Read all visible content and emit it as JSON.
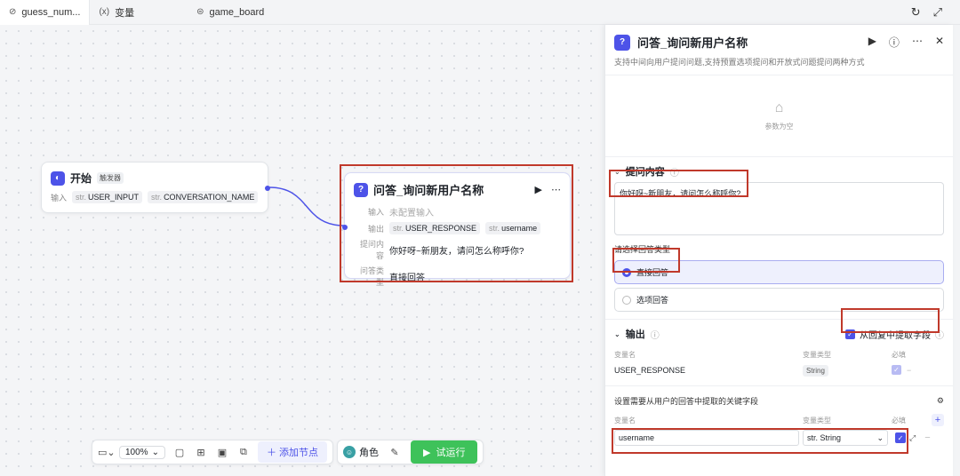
{
  "tabs": [
    {
      "icon": "⊘",
      "label": "guess_num..."
    },
    {
      "icon": "(x)",
      "label": "变量"
    },
    {
      "icon": "⊜",
      "label": "game_board"
    }
  ],
  "top_right": {
    "refresh": "↻",
    "expand": "⤢"
  },
  "start_node": {
    "title": "开始",
    "trigger_tag": "触发器",
    "input_label": "输入",
    "inputs": [
      {
        "type": "str.",
        "name": "USER_INPUT"
      },
      {
        "type": "str.",
        "name": "CONVERSATION_NAME"
      }
    ]
  },
  "qa_node": {
    "title": "问答_询问新用户名称",
    "input_label": "输入",
    "input_value": "未配置输入",
    "output_label": "输出",
    "outputs": [
      {
        "type": "str.",
        "name": "USER_RESPONSE"
      },
      {
        "type": "str.",
        "name": "username"
      }
    ],
    "prompt_label": "提问内容",
    "prompt_value": "你好呀~新朋友，请问怎么称呼你?",
    "answer_type_label": "问答类型",
    "answer_type_value": "直接回答"
  },
  "toolbar": {
    "zoom": "100%",
    "add_node": "添加节点",
    "role": "角色",
    "run": "试运行"
  },
  "panel": {
    "title": "问答_询问新用户名称",
    "description": "支持中间向用户提问问题,支持预置选项提问和开放式问题提问两种方式",
    "empty_params": "参数为空",
    "prompt_section": "提问内容",
    "prompt_text": "你好呀~新朋友，请问怎么称呼你?",
    "answer_type_prompt": "请选择回答类型",
    "answer_options": [
      {
        "label": "直接回答",
        "selected": true
      },
      {
        "label": "选项回答",
        "selected": false
      }
    ],
    "output_section": "输出",
    "extract_toggle": "从回复中提取字段",
    "col_var_name": "变量名",
    "col_var_type": "变量类型",
    "col_required": "必填",
    "output_rows": [
      {
        "name": "USER_RESPONSE",
        "type": "String"
      }
    ],
    "extract_title": "设置需要从用户的回答中提取的关键字段",
    "extract_rows": [
      {
        "name": "username",
        "type": "str. String"
      }
    ]
  },
  "colors": {
    "accent": "#4d53e8",
    "run": "#3ec25a",
    "highlight": "#c0392b"
  }
}
